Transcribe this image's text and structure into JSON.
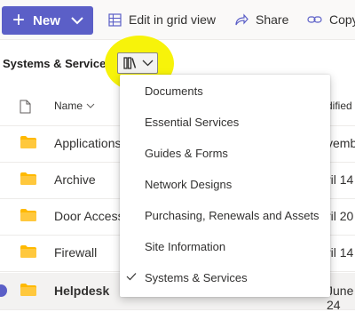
{
  "toolbar": {
    "new_label": "New",
    "edit_grid_label": "Edit in grid view",
    "share_label": "Share",
    "copy_label": "Copy"
  },
  "library": {
    "title": "Systems & Services"
  },
  "columns": {
    "name": "Name",
    "modified": "dified"
  },
  "rows": [
    {
      "name": "Applications",
      "modified": "vemb"
    },
    {
      "name": "Archive",
      "modified": "ril 14"
    },
    {
      "name": "Door Access",
      "modified": "ril 20"
    },
    {
      "name": "Firewall",
      "modified": "ril 14"
    },
    {
      "name": "Helpdesk",
      "modified": "June 24"
    }
  ],
  "view_menu": {
    "items": [
      {
        "label": "Documents",
        "checked": false
      },
      {
        "label": "Essential Services",
        "checked": false
      },
      {
        "label": "Guides & Forms",
        "checked": false
      },
      {
        "label": "Network Designs",
        "checked": false
      },
      {
        "label": "Purchasing, Renewals and Assets",
        "checked": false
      },
      {
        "label": "Site Information",
        "checked": false
      },
      {
        "label": "Systems & Services",
        "checked": true
      }
    ]
  },
  "colors": {
    "accent": "#5b5fc7",
    "folder": "#ffb900",
    "highlight": "#f7f30a"
  }
}
